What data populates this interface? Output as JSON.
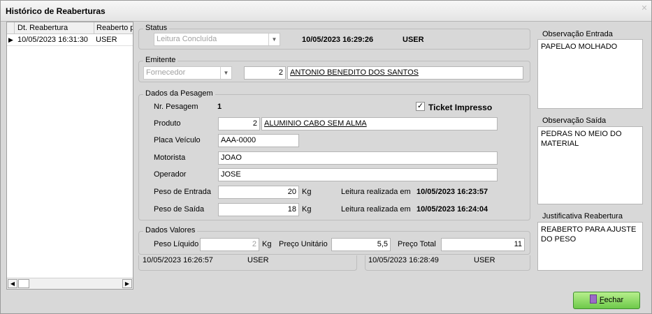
{
  "window": {
    "title": "Histórico de Reaberturas",
    "close_glyph": "✕"
  },
  "grid": {
    "columns": [
      "Dt. Reabertura",
      "Reaberto p"
    ],
    "rows": [
      {
        "indicator": "▶",
        "date": "10/05/2023 16:31:30",
        "user": "USER"
      }
    ],
    "scroll_left": "◀",
    "scroll_right": "▶"
  },
  "status": {
    "caption": "Status",
    "combo_value": "Leitura Concluída",
    "datetime": "10/05/2023 16:29:26",
    "user": "USER"
  },
  "emitente": {
    "caption": "Emitente",
    "combo_value": "Fornecedor",
    "code": "2",
    "name": "ANTONIO BENEDITO DOS SANTOS"
  },
  "pesagem": {
    "caption": "Dados da Pesagem",
    "nr_label": "Nr. Pesagem",
    "nr_value": "1",
    "ticket_label": "Ticket Impresso",
    "ticket_checked": "✓",
    "produto_label": "Produto",
    "produto_code": "2",
    "produto_name": "ALUMINIO CABO SEM ALMA",
    "placa_label": "Placa Veículo",
    "placa_value": "AAA-0000",
    "motorista_label": "Motorista",
    "motorista_value": "JOAO",
    "operador_label": "Operador",
    "operador_value": "JOSE",
    "entrada_label": "Peso de Entrada",
    "entrada_value": "20",
    "entrada_unit": "Kg",
    "entrada_leitura_label": "Leitura realizada em",
    "entrada_leitura_value": "10/05/2023 16:23:57",
    "saida_label": "Peso de Saída",
    "saida_value": "18",
    "saida_unit": "Kg",
    "saida_leitura_label": "Leitura realizada em",
    "saida_leitura_value": "10/05/2023 16:24:04"
  },
  "valores": {
    "caption": "Dados Valores",
    "liquido_label": "Peso Líquido",
    "liquido_value": "2",
    "liquido_unit": "Kg",
    "unitario_label": "Preço Unitário",
    "unitario_value": "5,5",
    "total_label": "Preço Total",
    "total_value": "11"
  },
  "footer": {
    "left_datetime": "10/05/2023 16:26:57",
    "left_user": "USER",
    "right_datetime": "10/05/2023 16:28:49",
    "right_user": "USER"
  },
  "obs_entrada": {
    "caption": "Observação Entrada",
    "text": "PAPELAO MOLHADO"
  },
  "obs_saida": {
    "caption": "Observação Saída",
    "text": "PEDRAS NO MEIO DO MATERIAL"
  },
  "justificativa": {
    "caption": "Justificativa Reabertura",
    "text": "REABERTO PARA AJUSTE DO PESO"
  },
  "buttons": {
    "fechar_prefix": "F",
    "fechar_rest": "echar"
  }
}
